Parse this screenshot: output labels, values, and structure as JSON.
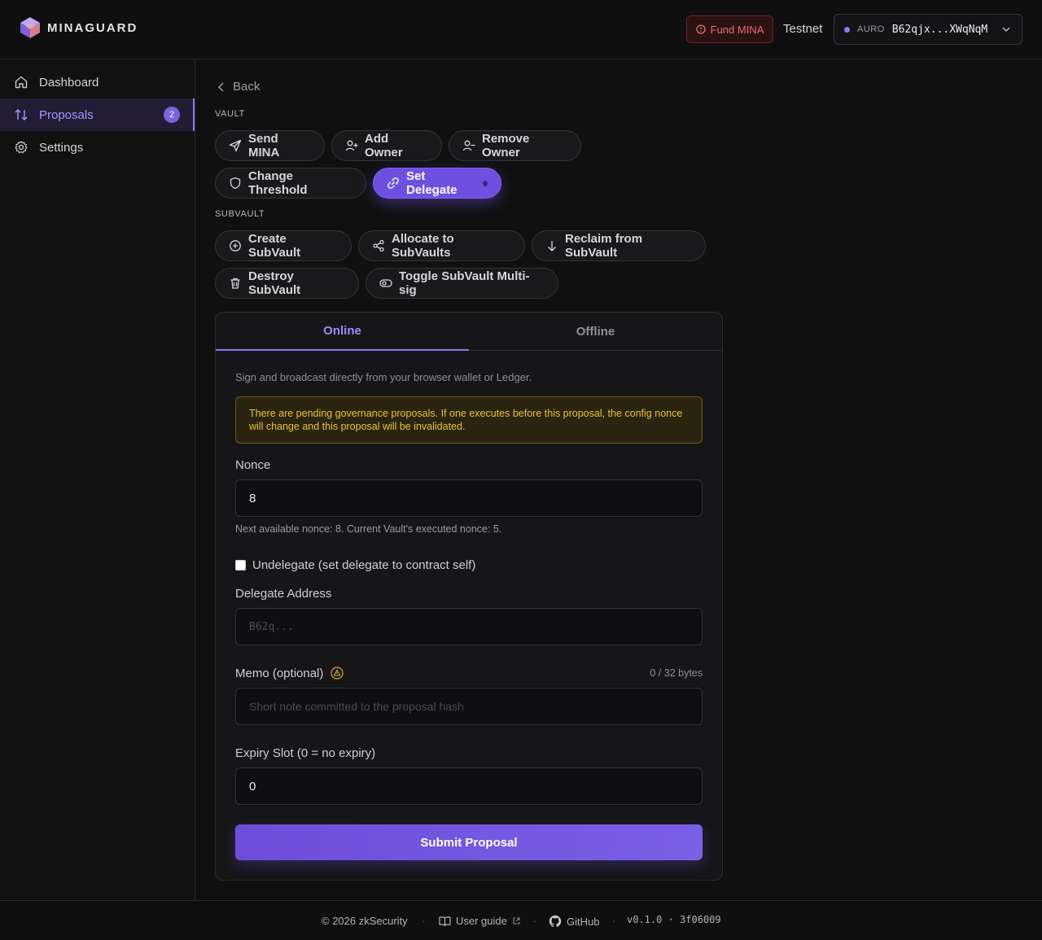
{
  "header": {
    "brand": "MINAGUARD",
    "fund_label": "Fund MINA",
    "network": "Testnet",
    "wallet_brand": "AURO",
    "wallet_address": "B62qjx...XWqNqM"
  },
  "sidebar": {
    "items": [
      {
        "label": "Dashboard"
      },
      {
        "label": "Proposals",
        "badge": "2"
      },
      {
        "label": "Settings"
      }
    ]
  },
  "main": {
    "back_label": "Back",
    "vault_label": "VAULT",
    "vault_actions": [
      "Send MINA",
      "Add Owner",
      "Remove Owner",
      "Change Threshold",
      "Set Delegate"
    ],
    "subvault_label": "SUBVAULT",
    "subvault_actions": [
      "Create SubVault",
      "Allocate to SubVaults",
      "Reclaim from SubVault",
      "Destroy SubVault",
      "Toggle SubVault Multi-sig"
    ]
  },
  "form": {
    "tabs": [
      "Online",
      "Offline"
    ],
    "description": "Sign and broadcast directly from your browser wallet or Ledger.",
    "warning": "There are pending governance proposals. If one executes before this proposal, the config nonce will change and this proposal will be invalidated.",
    "nonce_label": "Nonce",
    "nonce_value": "8",
    "nonce_hint": "Next available nonce: 8. Current Vault's executed nonce: 5.",
    "undelegate_label": "Undelegate (set delegate to contract self)",
    "delegate_label": "Delegate Address",
    "delegate_placeholder": "B62q...",
    "memo_label": "Memo (optional)",
    "memo_counter": "0 / 32 bytes",
    "memo_placeholder": "Short note committed to the proposal hash",
    "expiry_label": "Expiry Slot (0 = no expiry)",
    "expiry_value": "0",
    "submit_label": "Submit Proposal"
  },
  "footer": {
    "copyright": "© 2026 zkSecurity",
    "guide": "User guide",
    "github": "GitHub",
    "version": "v0.1.0 · 3f06009"
  },
  "colors": {
    "accent": "#7a63e0",
    "warning": "#e9c23a",
    "danger": "#f06a6f"
  }
}
